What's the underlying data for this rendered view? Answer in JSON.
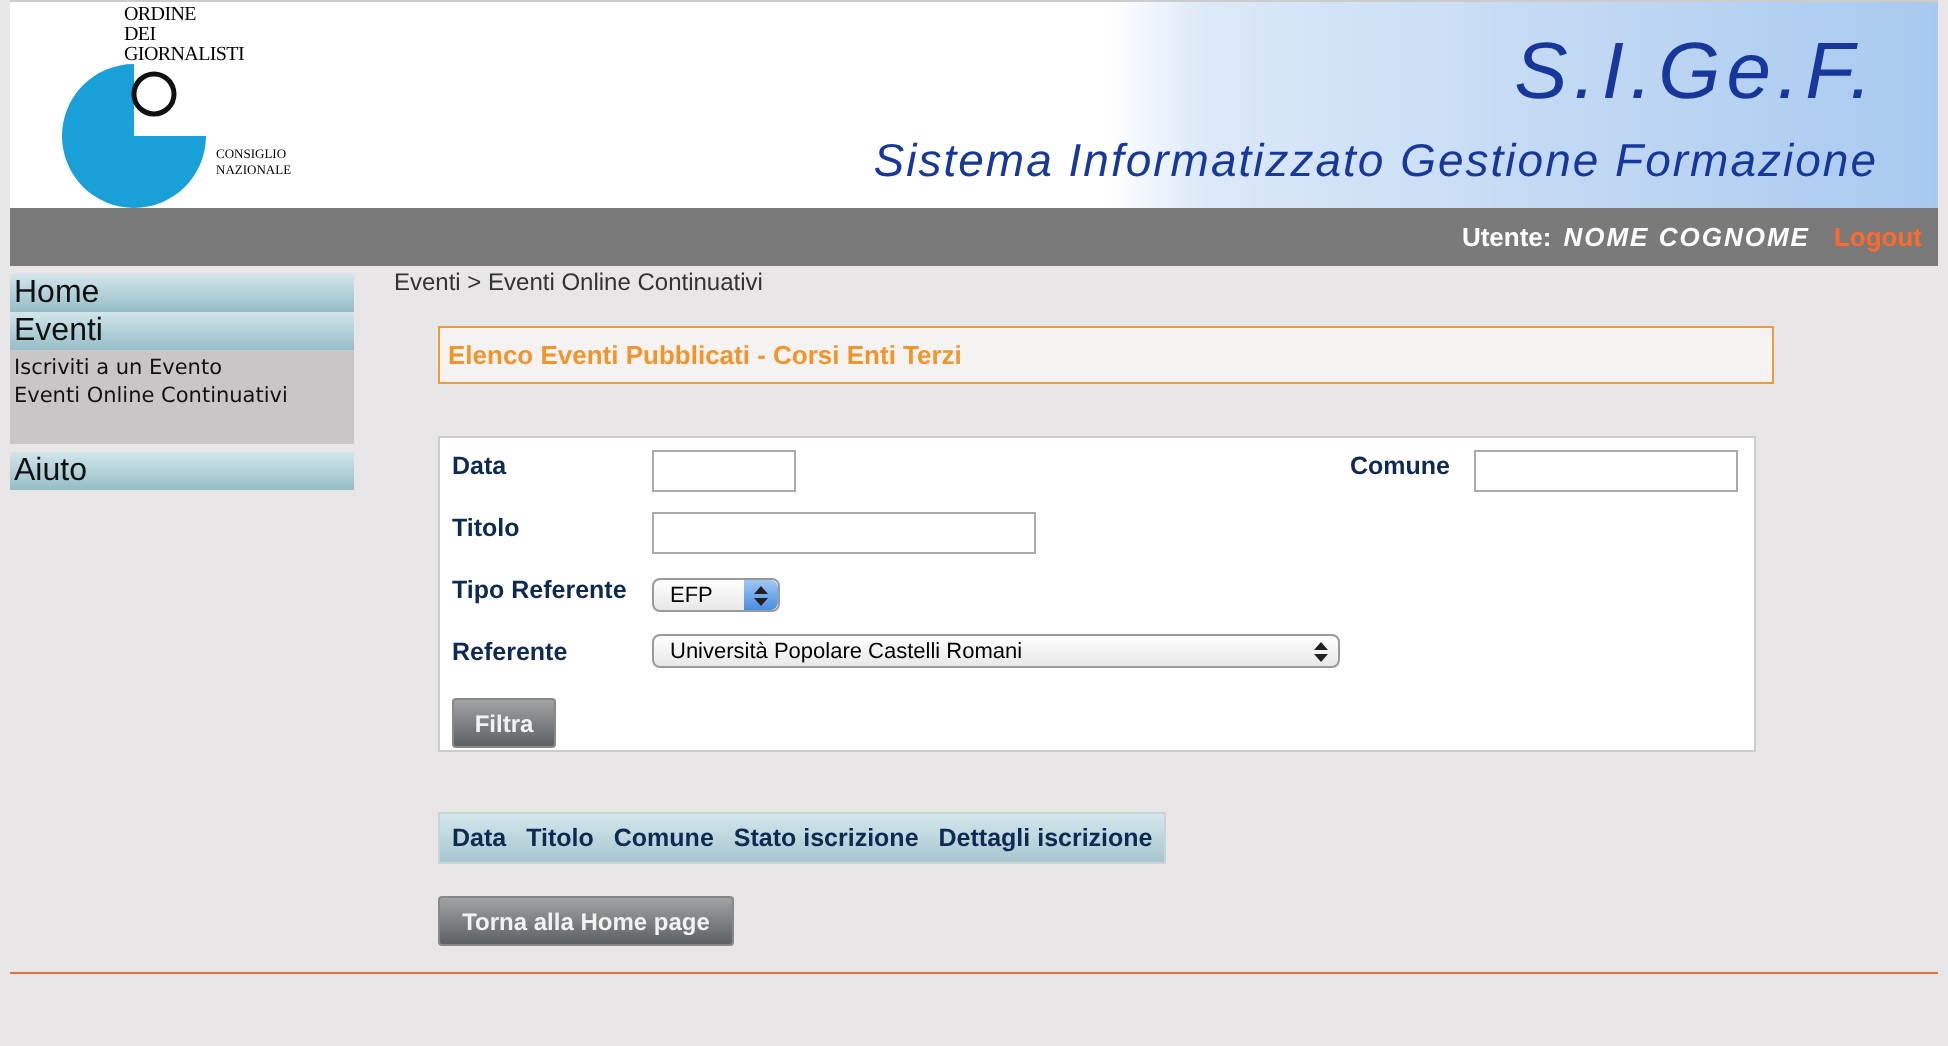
{
  "logo": {
    "top_text": [
      "ORDINE",
      "DEI",
      "GIORNALISTI"
    ],
    "side_text": [
      "CONSIGLIO",
      "NAZIONALE"
    ]
  },
  "header": {
    "title": "S.I.Ge.F.",
    "subtitle": "Sistema Informatizzato Gestione Formazione"
  },
  "user_bar": {
    "label": "Utente:",
    "user": "NOME COGNOME",
    "logout": "Logout"
  },
  "sidebar": {
    "sections": [
      {
        "title": "Home"
      },
      {
        "title": "Eventi",
        "items": [
          "Iscriviti a un Evento",
          "Eventi Online Continuativi"
        ]
      },
      {
        "title": "Aiuto"
      }
    ]
  },
  "breadcrumb": "Eventi > Eventi Online Continuativi",
  "panel_title": "Elenco Eventi Pubblicati - Corsi Enti Terzi",
  "form": {
    "rows": [
      [
        {
          "kind": "text",
          "label": "Data"
        },
        {
          "kind": "text",
          "label": "Comune"
        }
      ],
      [
        {
          "kind": "text",
          "label": "Titolo"
        }
      ],
      [
        {
          "kind": "select",
          "label": "Tipo Referente",
          "value": "EFP"
        }
      ],
      [
        {
          "kind": "select",
          "label": "Referente",
          "value": "Università Popolare Castelli Romani"
        }
      ]
    ],
    "button": "Filtra"
  },
  "table": {
    "columns": [
      "Data",
      "Titolo",
      "Comune",
      "Stato iscrizione",
      "Dettagli iscrizione"
    ]
  },
  "home_button": "Torna alla Home page"
}
